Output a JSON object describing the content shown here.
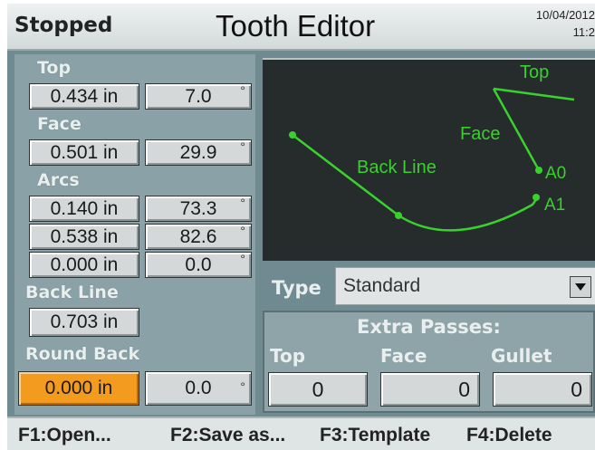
{
  "window": {
    "status": "Stopped",
    "title": "Tooth Editor",
    "date": "10/04/2012",
    "time": "11:2"
  },
  "left_panel": {
    "top": {
      "label": "Top",
      "length": "0.434 in",
      "angle": "7.0",
      "unit": "°"
    },
    "face": {
      "label": "Face",
      "length": "0.501 in",
      "angle": "29.9",
      "unit": "°"
    },
    "arcs": {
      "label": "Arcs",
      "rows": [
        {
          "length": "0.140 in",
          "angle": "73.3",
          "unit": "°"
        },
        {
          "length": "0.538 in",
          "angle": "82.6",
          "unit": "°"
        },
        {
          "length": "0.000 in",
          "angle": "0.0",
          "unit": "°"
        }
      ]
    },
    "back_line": {
      "label": "Back Line",
      "length": "0.703 in"
    },
    "round_back": {
      "label": "Round Back",
      "length": "0.000 in",
      "angle": "0.0",
      "unit": "°"
    }
  },
  "preview": {
    "labels": {
      "top": "Top",
      "face": "Face",
      "back_line": "Back Line",
      "a0": "A0",
      "a1": "A1"
    },
    "colors": {
      "background": "#262b2b",
      "line": "#39d12e"
    }
  },
  "type": {
    "label": "Type",
    "value": "Standard"
  },
  "extra_passes": {
    "header": "Extra Passes:",
    "columns": [
      {
        "label": "Top",
        "value": "0"
      },
      {
        "label": "Face",
        "value": "0"
      },
      {
        "label": "Gullet",
        "value": "0"
      }
    ]
  },
  "function_keys": [
    {
      "label": "F1:Open..."
    },
    {
      "label": "F2:Save as..."
    },
    {
      "label": "F3:Template"
    },
    {
      "label": "F4:Delete"
    }
  ],
  "colors": {
    "accent_orange": "#f39b1f",
    "panel": "#8aa2a7"
  }
}
